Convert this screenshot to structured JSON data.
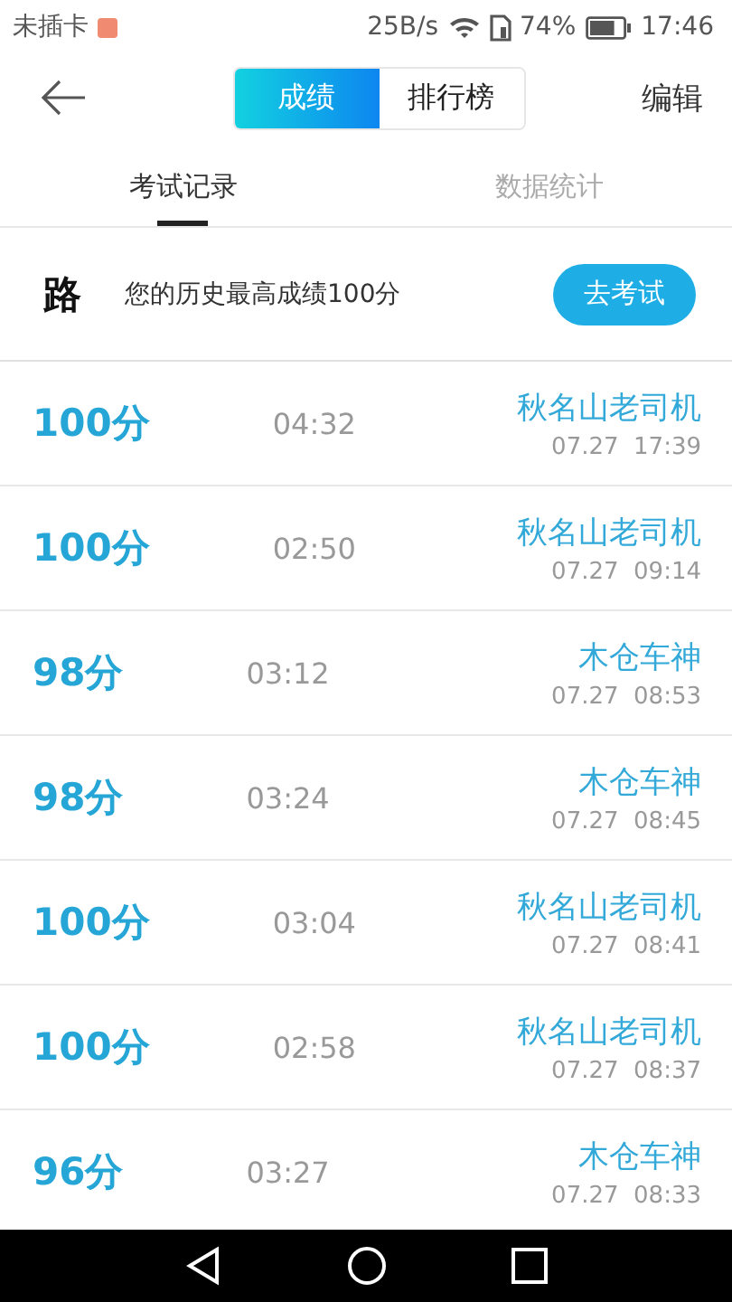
{
  "status_bar": {
    "carrier": "未插卡",
    "speed": "25B/s",
    "battery": "74%",
    "time": "17:46"
  },
  "header": {
    "segments": [
      {
        "label": "成绩",
        "selected": true
      },
      {
        "label": "排行榜",
        "selected": false
      }
    ],
    "action": "编辑"
  },
  "tabs": [
    {
      "label": "考试记录",
      "selected": true
    },
    {
      "label": "数据统计",
      "selected": false
    }
  ],
  "banner": {
    "logo": "路",
    "text": "您的历史最高成绩100分",
    "button": "去考试"
  },
  "records": [
    {
      "score": "100分",
      "duration": "04:32",
      "name": "秋名山老司机",
      "date": "07.27  17:39"
    },
    {
      "score": "100分",
      "duration": "02:50",
      "name": "秋名山老司机",
      "date": "07.27  09:14"
    },
    {
      "score": "98分",
      "duration": "03:12",
      "name": "木仓车神",
      "date": "07.27  08:53"
    },
    {
      "score": "98分",
      "duration": "03:24",
      "name": "木仓车神",
      "date": "07.27  08:45"
    },
    {
      "score": "100分",
      "duration": "03:04",
      "name": "秋名山老司机",
      "date": "07.27  08:41"
    },
    {
      "score": "100分",
      "duration": "02:58",
      "name": "秋名山老司机",
      "date": "07.27  08:37"
    },
    {
      "score": "96分",
      "duration": "03:27",
      "name": "木仓车神",
      "date": "07.27  08:33"
    }
  ]
}
